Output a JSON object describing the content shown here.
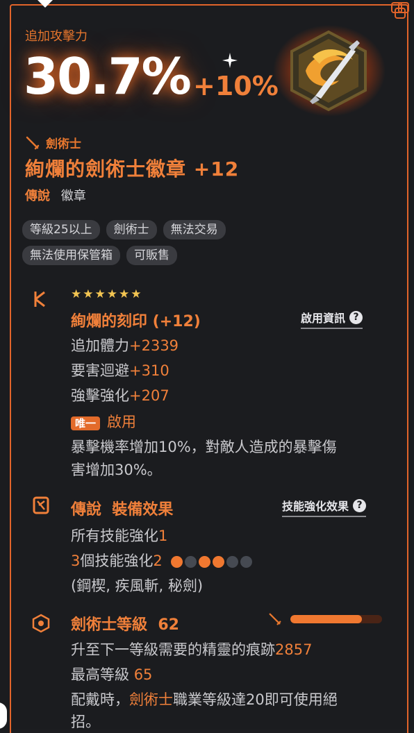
{
  "header": {
    "stat_label": "追加攻擊力",
    "stat_value": "30.7%",
    "stat_bonus": "+10%"
  },
  "item": {
    "class_label": "劍術士",
    "name": "絢爛的劍術士徽章 +12",
    "rarity": "傳說",
    "kind": "徽章",
    "tags": [
      "等級25以上",
      "劍術士",
      "無法交易",
      "無法使用保管箱",
      "可販售"
    ]
  },
  "engraving": {
    "stars": "★★★★★★",
    "title": "絢爛的刻印 (+12)",
    "info_link": "啟用資訊",
    "stats": [
      {
        "name": "追加體力",
        "value": "+2339"
      },
      {
        "name": "要害迴避",
        "value": "+310"
      },
      {
        "name": "強擊強化",
        "value": "+207"
      }
    ],
    "unique_badge": "唯一",
    "unique_label": "啟用",
    "desc_line1": "暴擊機率增加10%，對敵人造成的暴擊傷",
    "desc_line2": "害增加30%。"
  },
  "equip_effect": {
    "rarity": "傳說",
    "title": "裝備效果",
    "skill_link": "技能強化效果",
    "line1_text": "所有技能強化",
    "line1_value": "1",
    "line2_prefix": "3",
    "line2_text": "個技能強化",
    "line2_value": "2",
    "dots_filled": [
      true,
      false,
      true,
      true,
      false,
      false
    ],
    "line3": "(鋼楔, 疾風斬, 秘劍)"
  },
  "class_level": {
    "title": "劍術士等級",
    "level": "62",
    "progress": 0.78,
    "next_text": "升至下一等級需要的精靈的痕跡",
    "next_value": "2857",
    "max_text": "最高等級",
    "max_value": "65",
    "equip_prefix": "配戴時，",
    "equip_class": "劍術士",
    "equip_suffix": "職業等級達20即可使用絕",
    "equip_line2": "招。"
  },
  "colors": {
    "accent": "#f0803a",
    "frame": "#e2642a",
    "background": "#1b1c1f",
    "tag_bg": "#3a3b40",
    "star": "#f3c552"
  },
  "icons": [
    "sparkle-icon",
    "emblem-icon",
    "sword-icon",
    "engraving-icon",
    "legend-icon",
    "class-level-icon",
    "question-icon"
  ]
}
